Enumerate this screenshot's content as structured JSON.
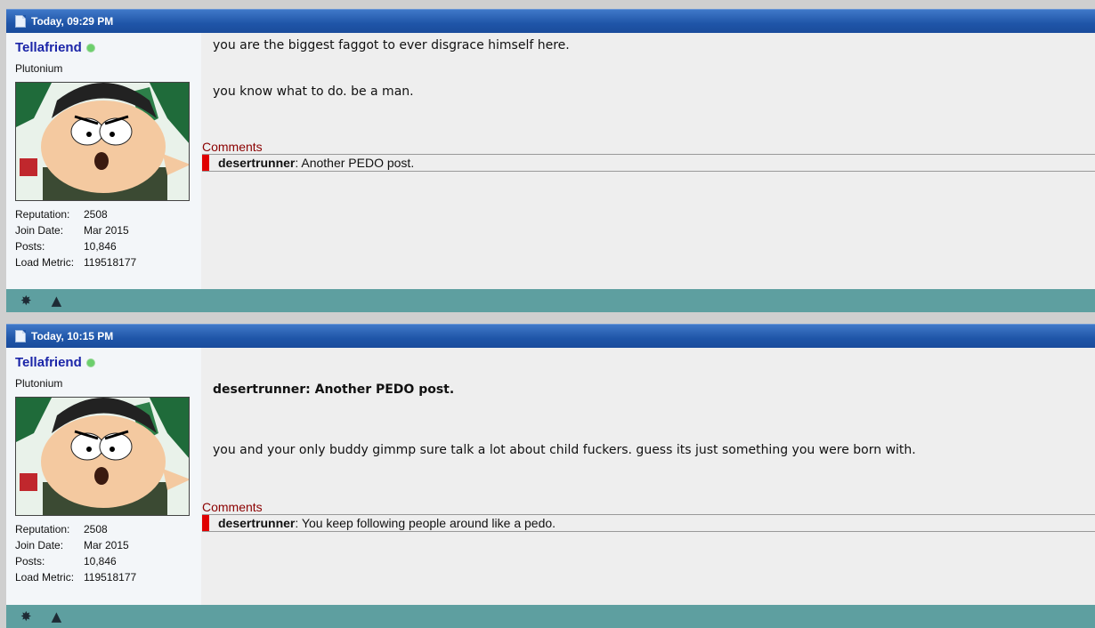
{
  "posts": [
    {
      "date": "Today, 09:29 PM",
      "username": "Tellafriend",
      "usertitle": "Plutonium",
      "stats": [
        {
          "label": "Reputation:",
          "value": "2508"
        },
        {
          "label": "Join Date:",
          "value": "Mar 2015"
        },
        {
          "label": "Posts:",
          "value": "10,846"
        },
        {
          "label": "Load Metric:",
          "value": "119518177"
        }
      ],
      "lines": [
        "you are the biggest faggot to ever disgrace himself here.",
        "you know what to do. be a man."
      ],
      "comments_label": "Comments",
      "comment": {
        "author": "desertrunner",
        "text": ": Another PEDO post."
      }
    },
    {
      "date": "Today, 10:15 PM",
      "username": "Tellafriend",
      "usertitle": "Plutonium",
      "stats": [
        {
          "label": "Reputation:",
          "value": "2508"
        },
        {
          "label": "Join Date:",
          "value": "Mar 2015"
        },
        {
          "label": "Posts:",
          "value": "10,846"
        },
        {
          "label": "Load Metric:",
          "value": "119518177"
        }
      ],
      "quote": "desertrunner: Another PEDO post.",
      "lines": [
        "you and your only buddy gimmp sure talk a lot about child fuckers. guess its just something you were born with."
      ],
      "comments_label": "Comments",
      "comment": {
        "author": "desertrunner",
        "text": ": You keep following people around like a pedo."
      }
    }
  ],
  "footer_icons": [
    "star-icon",
    "warning-icon"
  ],
  "colors": {
    "header": "#1f55a8",
    "footer": "#5e9fa0",
    "comment_bar": "#e00000",
    "username": "#1b25a8"
  }
}
